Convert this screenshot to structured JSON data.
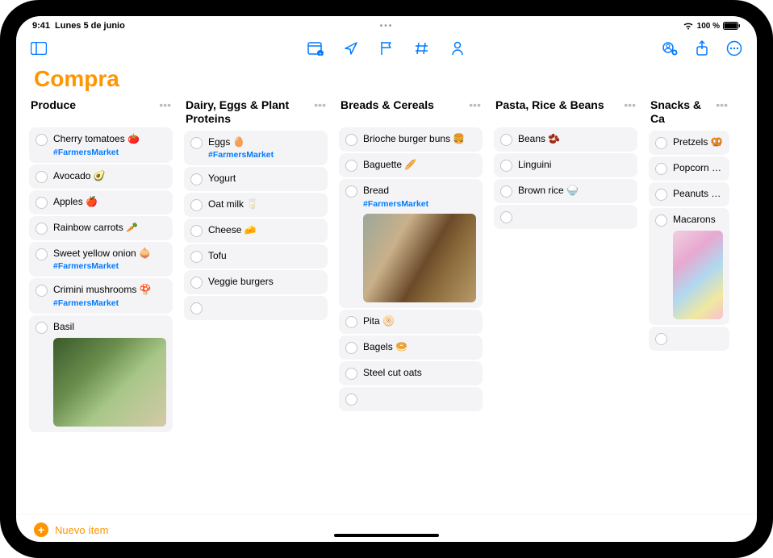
{
  "status": {
    "time": "9:41",
    "date": "Lunes 5 de junio",
    "battery": "100 %"
  },
  "list_title": "Compra",
  "new_item_label": "Nuevo ítem",
  "columns": [
    {
      "title": "Produce",
      "items": [
        {
          "label": "Cherry tomatoes 🍅",
          "tag": "#FarmersMarket"
        },
        {
          "label": "Avocado 🥑"
        },
        {
          "label": "Apples 🍎"
        },
        {
          "label": "Rainbow carrots 🥕"
        },
        {
          "label": "Sweet yellow onion 🧅",
          "tag": "#FarmersMarket"
        },
        {
          "label": "Crimini mushrooms 🍄",
          "tag": "#FarmersMarket"
        },
        {
          "label": "Basil",
          "image": "basil"
        }
      ]
    },
    {
      "title": "Dairy, Eggs & Plant Proteins",
      "items": [
        {
          "label": "Eggs 🥚",
          "tag": "#FarmersMarket"
        },
        {
          "label": "Yogurt"
        },
        {
          "label": "Oat milk 🥛"
        },
        {
          "label": "Cheese 🧀"
        },
        {
          "label": "Tofu"
        },
        {
          "label": "Veggie burgers"
        },
        {
          "empty": true
        }
      ]
    },
    {
      "title": "Breads & Cereals",
      "items": [
        {
          "label": "Brioche burger buns 🍔"
        },
        {
          "label": "Baguette 🥖"
        },
        {
          "label": "Bread",
          "tag": "#FarmersMarket",
          "image": "bread"
        },
        {
          "label": "Pita 🫓"
        },
        {
          "label": "Bagels 🥯"
        },
        {
          "label": "Steel cut oats"
        },
        {
          "empty": true
        }
      ]
    },
    {
      "title": "Pasta, Rice & Beans",
      "items": [
        {
          "label": "Beans 🫘"
        },
        {
          "label": "Linguini"
        },
        {
          "label": "Brown rice 🍚"
        },
        {
          "empty": true
        }
      ]
    },
    {
      "title": "Snacks & Ca",
      "partial": true,
      "items": [
        {
          "label": "Pretzels 🥨"
        },
        {
          "label": "Popcorn 🍿"
        },
        {
          "label": "Peanuts 🥜"
        },
        {
          "label": "Macarons",
          "image": "macarons"
        },
        {
          "empty": true
        }
      ]
    }
  ]
}
